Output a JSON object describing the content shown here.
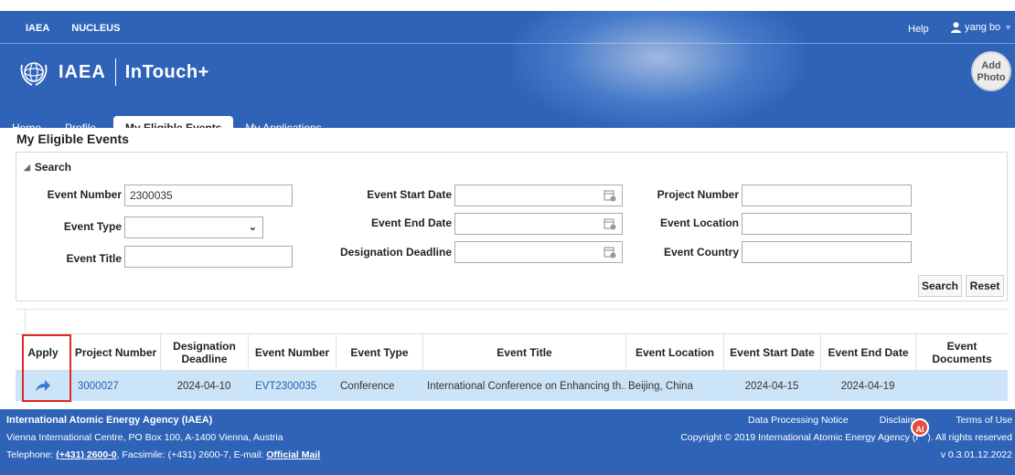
{
  "header": {
    "nav_left": [
      "IAEA",
      "NUCLEUS"
    ],
    "help": "Help",
    "user": "yang bo",
    "brand_org": "IAEA",
    "brand_product": "InTouch+",
    "add_photo": "Add Photo"
  },
  "tabs": [
    {
      "label": "Home",
      "active": false
    },
    {
      "label": "Profile",
      "active": false
    },
    {
      "label": "My Eligible Events",
      "active": true
    },
    {
      "label": "My Applications",
      "active": false
    }
  ],
  "page_title": "My Eligible Events",
  "search": {
    "title": "Search",
    "event_number_label": "Event Number",
    "event_number_value": "2300035",
    "event_type_label": "Event Type",
    "event_type_value": "",
    "event_title_label": "Event Title",
    "event_title_value": "",
    "event_start_date_label": "Event Start Date",
    "event_end_date_label": "Event End Date",
    "designation_deadline_label": "Designation Deadline",
    "project_number_label": "Project Number",
    "event_location_label": "Event Location",
    "event_country_label": "Event Country",
    "search_button": "Search",
    "reset_button": "Reset"
  },
  "table": {
    "columns": [
      "Apply",
      "Project Number",
      "Designation Deadline",
      "Event Number",
      "Event Type",
      "Event Title",
      "Event Location",
      "Event Start Date",
      "Event End Date",
      "Event Documents"
    ],
    "rows": [
      {
        "project_number": "3000027",
        "designation_deadline": "2024-04-10",
        "event_number": "EVT2300035",
        "event_type": "Conference",
        "event_title": "International Conference on Enhancing th...",
        "event_location": "Beijing, China",
        "event_start_date": "2024-04-15",
        "event_end_date": "2024-04-19",
        "event_documents": ""
      }
    ]
  },
  "footer": {
    "org": "International Atomic Energy Agency (IAEA)",
    "address": "Vienna International Centre, PO Box 100, A-1400 Vienna, Austria",
    "tel_prefix": "Telephone: ",
    "tel_number": "(+431) 2600-0",
    "tel_middle": ", Facsimile: (+431) 2600-7, E-mail: ",
    "email_link": "Official Mail",
    "data_processing": "Data Processing Notice",
    "disclaimer": "Disclaim",
    "terms": "Terms of Use",
    "copyright": "Copyright © 2019 International Atomic Energy Agency (I",
    "rights": "). All rights reserved",
    "version": "v 0.3.01.12.2022",
    "ai_badge": "AI"
  },
  "colors": {
    "brand_blue": "#2e63b8",
    "row_highlight": "#cce4f7",
    "link": "#2860b0",
    "annotation_red": "#e02626"
  }
}
